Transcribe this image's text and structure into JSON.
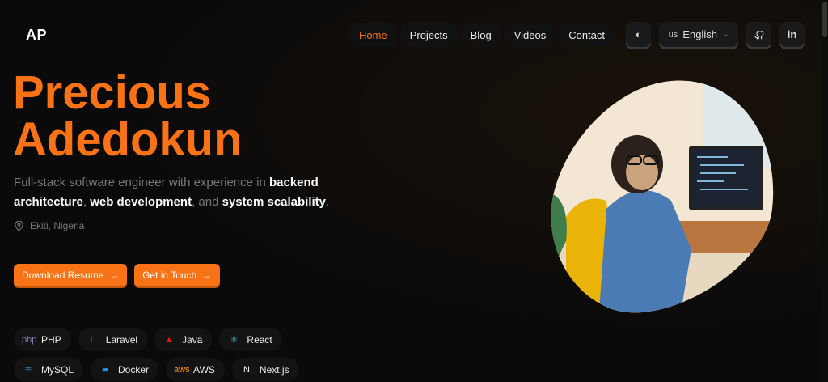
{
  "logo": "AP",
  "nav": [
    {
      "label": "Home",
      "active": true
    },
    {
      "label": "Projects"
    },
    {
      "label": "Blog"
    },
    {
      "label": "Videos"
    },
    {
      "label": "Contact"
    }
  ],
  "language": {
    "code": "us",
    "label": "English"
  },
  "hero": {
    "name_line1": "Precious",
    "name_line2": "Adedokun",
    "desc": [
      "Full-stack software engineer with experience in ",
      "backend architecture",
      ", ",
      "web development",
      ", and ",
      "system scalability",
      "."
    ],
    "location": "Ekiti, Nigeria",
    "buttons": {
      "resume": "Download Resume",
      "contact": "Get in Touch",
      "arrow": "→"
    }
  },
  "skills": [
    {
      "label": "PHP",
      "icon": "php",
      "color": "#7b7fb5",
      "glyph": "php"
    },
    {
      "label": "Laravel",
      "icon": "laravel",
      "color": "#e0312c",
      "glyph": "L"
    },
    {
      "label": "Java",
      "icon": "java",
      "color": "#e11",
      "glyph": "▲"
    },
    {
      "label": "React",
      "icon": "react",
      "color": "#5ed3f3",
      "glyph": "⚛"
    },
    {
      "label": "MySQL",
      "icon": "mysql",
      "color": "#4479a1",
      "glyph": "≋"
    },
    {
      "label": "Docker",
      "icon": "docker",
      "color": "#2496ed",
      "glyph": "▰"
    },
    {
      "label": "AWS",
      "icon": "aws",
      "color": "#f90",
      "glyph": "aws"
    },
    {
      "label": "Next.js",
      "icon": "nextjs",
      "color": "#fff",
      "glyph": "N"
    }
  ],
  "colors": {
    "accent": "#f97316"
  }
}
